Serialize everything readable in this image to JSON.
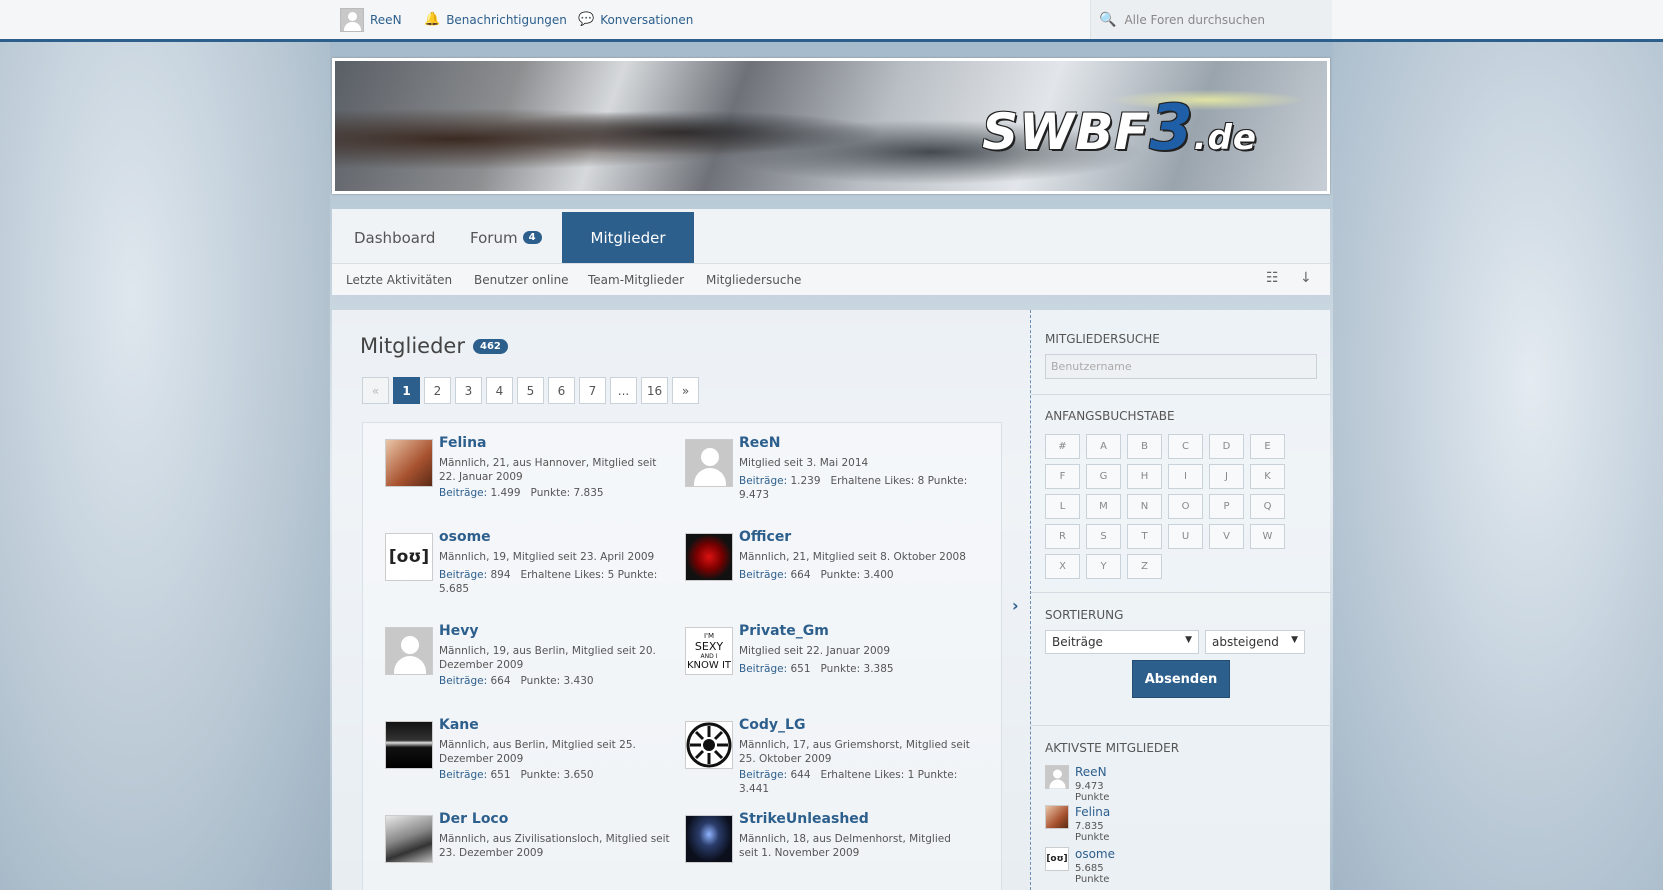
{
  "colors": {
    "primary": "#2d5f8d",
    "link": "#2d5f8d"
  },
  "topbar": {
    "user": "ReeN",
    "notifications": "Benachrichtigungen",
    "conversations": "Konversationen",
    "search_placeholder": "Alle Foren durchsuchen"
  },
  "banner": {
    "logo_main": "SWBF",
    "logo_num": "3",
    "logo_tld": ".de"
  },
  "nav": {
    "tabs": [
      {
        "label": "Dashboard"
      },
      {
        "label": "Forum",
        "badge": "4"
      },
      {
        "label": "Mitglieder"
      }
    ],
    "subnav": [
      "Letzte Aktivitäten",
      "Benutzer online",
      "Team-Mitglieder",
      "Mitgliedersuche"
    ]
  },
  "main": {
    "title": "Mitglieder",
    "count": "462",
    "pagination": [
      "«",
      "1",
      "2",
      "3",
      "4",
      "5",
      "6",
      "7",
      "...",
      "16",
      "»"
    ],
    "members": [
      {
        "name": "Felina",
        "info": "Männlich, 21, aus Hannover, Mitglied seit 22. Januar 2009",
        "posts_label": "Beiträge:",
        "posts": "1.499",
        "extra": "Punkte: 7.835"
      },
      {
        "name": "ReeN",
        "info": "Mitglied seit 3. Mai 2014",
        "posts_label": "Beiträge:",
        "posts": "1.239",
        "extra": "Erhaltene Likes: 8 Punkte: 9.473"
      },
      {
        "name": "osome",
        "info": "Männlich, 19, Mitglied seit 23. April 2009",
        "posts_label": "Beiträge:",
        "posts": "894",
        "extra": "Erhaltene Likes: 5 Punkte: 5.685"
      },
      {
        "name": "Officer",
        "info": "Männlich, 21, Mitglied seit 8. Oktober 2008",
        "posts_label": "Beiträge:",
        "posts": "664",
        "extra": "Punkte: 3.400"
      },
      {
        "name": "Hevy",
        "info": "Männlich, 19, aus Berlin, Mitglied seit 20. Dezember 2009",
        "posts_label": "Beiträge:",
        "posts": "664",
        "extra": "Punkte: 3.430"
      },
      {
        "name": "Private_Gm",
        "info": "Mitglied seit 22. Januar 2009",
        "posts_label": "Beiträge:",
        "posts": "651",
        "extra": "Punkte: 3.385"
      },
      {
        "name": "Kane",
        "info": "Männlich, aus Berlin, Mitglied seit 25. Dezember 2009",
        "posts_label": "Beiträge:",
        "posts": "651",
        "extra": "Punkte: 3.650"
      },
      {
        "name": "Cody_LG",
        "info": "Männlich, 17, aus Griemshorst, Mitglied seit 25. Oktober 2009",
        "posts_label": "Beiträge:",
        "posts": "644",
        "extra": "Erhaltene Likes: 1 Punkte: 3.441"
      },
      {
        "name": "Der Loco",
        "info": "Männlich, aus Zivilisationsloch, Mitglied seit 23. Dezember 2009",
        "posts_label": "",
        "posts": "",
        "extra": ""
      },
      {
        "name": "StrikeUnleashed",
        "info": "Männlich, 18, aus Delmenhorst, Mitglied seit 1. November 2009",
        "posts_label": "",
        "posts": "",
        "extra": ""
      }
    ],
    "private_gm_avatar": [
      "I'M",
      "SEXY",
      "AND I",
      "KNOW IT"
    ],
    "osome_avatar": "[oʊ]"
  },
  "sidebar": {
    "search_title": "Mitgliedersuche",
    "search_placeholder": "Benutzername",
    "letters_title": "Anfangsbuchstabe",
    "letters": [
      "#",
      "A",
      "B",
      "C",
      "D",
      "E",
      "F",
      "G",
      "H",
      "I",
      "J",
      "K",
      "L",
      "M",
      "N",
      "O",
      "P",
      "Q",
      "R",
      "S",
      "T",
      "U",
      "V",
      "W",
      "X",
      "Y",
      "Z"
    ],
    "sort_title": "Sortierung",
    "sort_field": "Beiträge",
    "sort_order": "absteigend",
    "submit": "Absenden",
    "active_title": "Aktivste Mitglieder",
    "active": [
      {
        "name": "ReeN",
        "points": "9.473 Punkte"
      },
      {
        "name": "Felina",
        "points": "7.835 Punkte"
      },
      {
        "name": "osome",
        "points": "5.685 Punkte"
      }
    ],
    "osome_small": "[oʊ]"
  }
}
